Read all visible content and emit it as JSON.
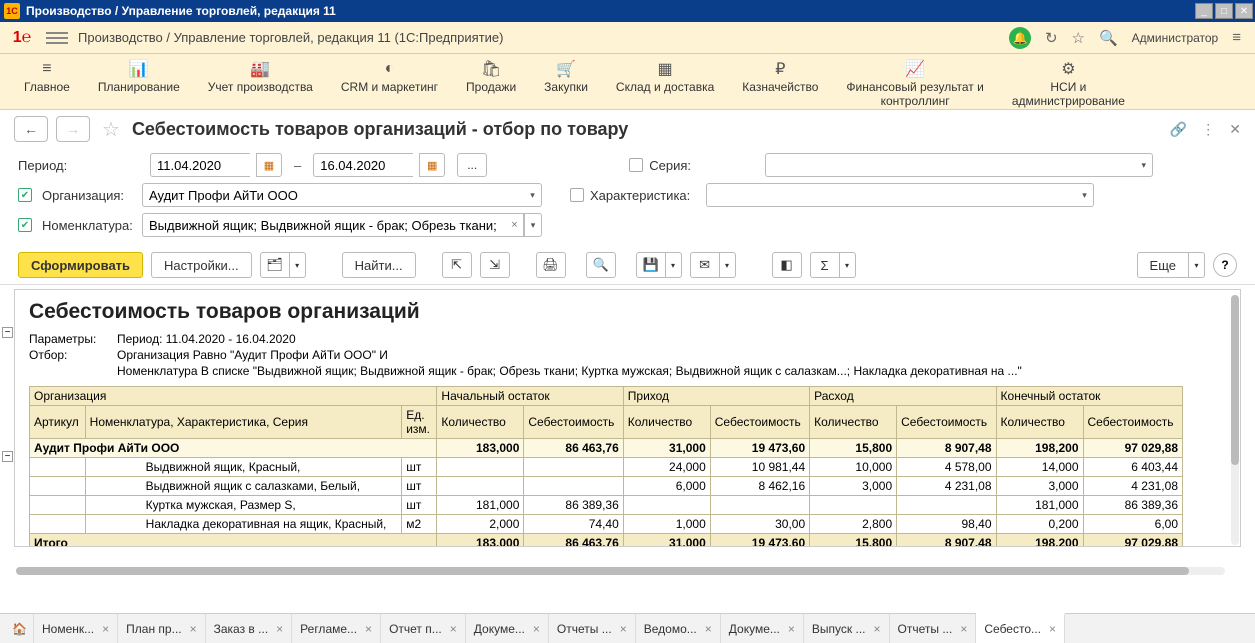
{
  "titlebar": {
    "text": "Производство / Управление торговлей, редакция 11"
  },
  "app_header": {
    "text": "Производство / Управление торговлей, редакция 11  (1С:Предприятие)",
    "admin": "Администратор"
  },
  "nav": [
    "Главное",
    "Планирование",
    "Учет производства",
    "CRM и маркетинг",
    "Продажи",
    "Закупки",
    "Склад и доставка",
    "Казначейство",
    "Финансовый результат и\nконтроллинг",
    "НСИ и\nадминистрирование"
  ],
  "page": {
    "title": "Себестоимость товаров организаций - отбор по товару"
  },
  "filters": {
    "period_label": "Период:",
    "date_from": "11.04.2020",
    "date_to": "16.04.2020",
    "org_label": "Организация:",
    "org_value": "Аудит Профи АйТи ООО",
    "nom_label": "Номенклатура:",
    "nom_value": "Выдвижной ящик; Выдвижной ящик - брак; Обрезь ткани; К ...",
    "series_label": "Серия:",
    "char_label": "Характеристика:"
  },
  "toolbar": {
    "generate": "Сформировать",
    "settings": "Настройки...",
    "find": "Найти...",
    "more": "Еще"
  },
  "report": {
    "title": "Себестоимость товаров организаций",
    "params_label": "Параметры:",
    "params_text": "Период: 11.04.2020 - 16.04.2020",
    "filter_label": "Отбор:",
    "filter_text1": "Организация Равно \"Аудит Профи АйТи ООО\" И",
    "filter_text2": "Номенклатура В списке \"Выдвижной ящик; Выдвижной ящик - брак; Обрезь ткани; Куртка мужская; Выдвижной ящик с салазкам...; Накладка декоративная на ...\"",
    "headers": {
      "org": "Организация",
      "art": "Артикул",
      "nom": "Номенклатура, Характеристика, Серия",
      "unit": "Ед.\nизм.",
      "start": "Начальный остаток",
      "in": "Приход",
      "out": "Расход",
      "end": "Конечный остаток",
      "qty": "Количество",
      "cost": "Себестоимость"
    },
    "group": "Аудит Профи АйТи ООО",
    "group_vals": [
      "183,000",
      "86 463,76",
      "31,000",
      "19 473,60",
      "15,800",
      "8 907,48",
      "198,200",
      "97 029,88"
    ],
    "rows": [
      {
        "nom": "Выдвижной ящик, Красный,",
        "unit": "шт",
        "v": [
          "",
          "",
          "24,000",
          "10 981,44",
          "10,000",
          "4 578,00",
          "14,000",
          "6 403,44"
        ]
      },
      {
        "nom": "Выдвижной ящик с салазками, Белый,",
        "unit": "шт",
        "v": [
          "",
          "",
          "6,000",
          "8 462,16",
          "3,000",
          "4 231,08",
          "3,000",
          "4 231,08"
        ]
      },
      {
        "nom": "Куртка мужская, Размер S,",
        "unit": "шт",
        "v": [
          "181,000",
          "86 389,36",
          "",
          "",
          "",
          "",
          "181,000",
          "86 389,36"
        ]
      },
      {
        "nom": "Накладка декоративная на ящик, Красный,",
        "unit": "м2",
        "v": [
          "2,000",
          "74,40",
          "1,000",
          "30,00",
          "2,800",
          "98,40",
          "0,200",
          "6,00"
        ]
      }
    ],
    "total_label": "Итого",
    "total_vals": [
      "183,000",
      "86 463,76",
      "31,000",
      "19 473,60",
      "15,800",
      "8 907,48",
      "198,200",
      "97 029,88"
    ]
  },
  "tabs": [
    "Номенк...",
    "План пр...",
    "Заказ в ...",
    "Регламе...",
    "Отчет п...",
    "Докуме...",
    "Отчеты ...",
    "Ведомо...",
    "Докуме...",
    "Выпуск ...",
    "Отчеты ...",
    "Себесто..."
  ]
}
